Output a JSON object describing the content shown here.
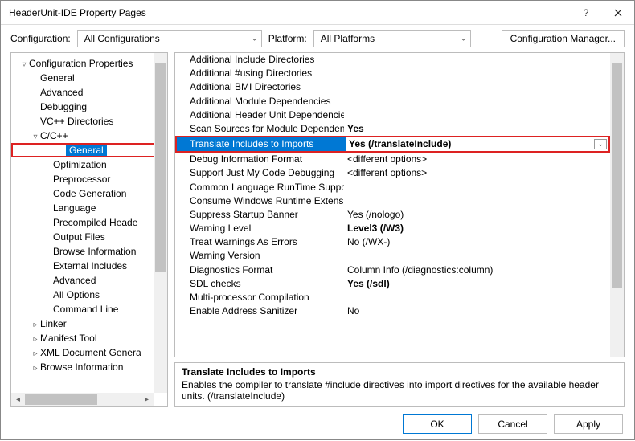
{
  "window": {
    "title": "HeaderUnit-IDE Property Pages"
  },
  "toolbar": {
    "configLabel": "Configuration:",
    "configValue": "All Configurations",
    "platformLabel": "Platform:",
    "platformValue": "All Platforms",
    "configMgr": "Configuration Manager..."
  },
  "tree": [
    {
      "level": 0,
      "exp": "▿",
      "label": "Configuration Properties"
    },
    {
      "level": 1,
      "exp": "",
      "label": "General"
    },
    {
      "level": 1,
      "exp": "",
      "label": "Advanced"
    },
    {
      "level": 1,
      "exp": "",
      "label": "Debugging"
    },
    {
      "level": 1,
      "exp": "",
      "label": "VC++ Directories"
    },
    {
      "level": 1,
      "exp": "▿",
      "label": "C/C++"
    },
    {
      "level": 2,
      "exp": "",
      "label": "General",
      "selected": true
    },
    {
      "level": 2,
      "exp": "",
      "label": "Optimization"
    },
    {
      "level": 2,
      "exp": "",
      "label": "Preprocessor"
    },
    {
      "level": 2,
      "exp": "",
      "label": "Code Generation"
    },
    {
      "level": 2,
      "exp": "",
      "label": "Language"
    },
    {
      "level": 2,
      "exp": "",
      "label": "Precompiled Heade"
    },
    {
      "level": 2,
      "exp": "",
      "label": "Output Files"
    },
    {
      "level": 2,
      "exp": "",
      "label": "Browse Information"
    },
    {
      "level": 2,
      "exp": "",
      "label": "External Includes"
    },
    {
      "level": 2,
      "exp": "",
      "label": "Advanced"
    },
    {
      "level": 2,
      "exp": "",
      "label": "All Options"
    },
    {
      "level": 2,
      "exp": "",
      "label": "Command Line"
    },
    {
      "level": 1,
      "exp": "▹",
      "label": "Linker"
    },
    {
      "level": 1,
      "exp": "▹",
      "label": "Manifest Tool"
    },
    {
      "level": 1,
      "exp": "▹",
      "label": "XML Document Genera"
    },
    {
      "level": 1,
      "exp": "▹",
      "label": "Browse Information"
    }
  ],
  "props": [
    {
      "name": "Additional Include Directories",
      "value": ""
    },
    {
      "name": "Additional #using Directories",
      "value": ""
    },
    {
      "name": "Additional BMI Directories",
      "value": ""
    },
    {
      "name": "Additional Module Dependencies",
      "value": ""
    },
    {
      "name": "Additional Header Unit Dependencies",
      "value": ""
    },
    {
      "name": "Scan Sources for Module Dependencies",
      "value": "Yes",
      "bold": true
    },
    {
      "name": "Translate Includes to Imports",
      "value": "Yes (/translateInclude)",
      "bold": true,
      "highlight": true
    },
    {
      "name": "Debug Information Format",
      "value": "<different options>"
    },
    {
      "name": "Support Just My Code Debugging",
      "value": "<different options>"
    },
    {
      "name": "Common Language RunTime Support",
      "value": ""
    },
    {
      "name": "Consume Windows Runtime Extension",
      "value": ""
    },
    {
      "name": "Suppress Startup Banner",
      "value": "Yes (/nologo)"
    },
    {
      "name": "Warning Level",
      "value": "Level3 (/W3)",
      "bold": true
    },
    {
      "name": "Treat Warnings As Errors",
      "value": "No (/WX-)"
    },
    {
      "name": "Warning Version",
      "value": ""
    },
    {
      "name": "Diagnostics Format",
      "value": "Column Info (/diagnostics:column)"
    },
    {
      "name": "SDL checks",
      "value": "Yes (/sdl)",
      "bold": true
    },
    {
      "name": "Multi-processor Compilation",
      "value": ""
    },
    {
      "name": "Enable Address Sanitizer",
      "value": "No"
    }
  ],
  "desc": {
    "title": "Translate Includes to Imports",
    "text": "Enables the compiler to translate #include directives into import directives for the available header units. (/translateInclude)"
  },
  "footer": {
    "ok": "OK",
    "cancel": "Cancel",
    "apply": "Apply"
  }
}
